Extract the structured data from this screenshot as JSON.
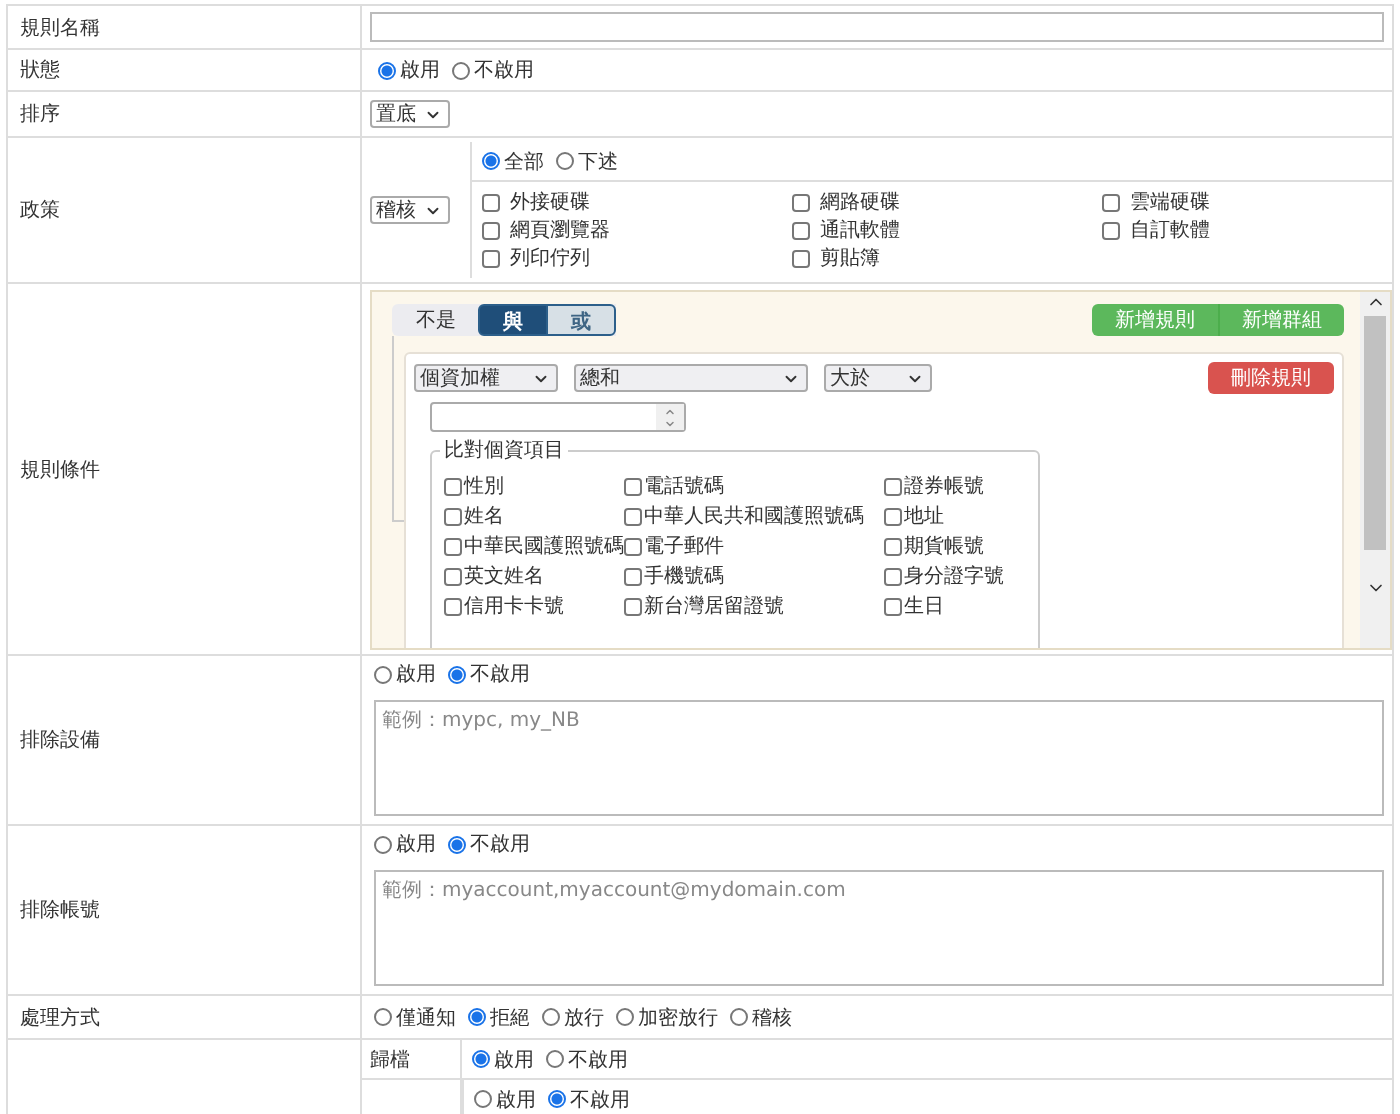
{
  "name_row": {
    "label": "規則名稱"
  },
  "status": {
    "label": "狀態",
    "options": [
      {
        "label": "啟用",
        "selected": true
      },
      {
        "label": "不啟用",
        "selected": false
      }
    ]
  },
  "order": {
    "label": "排序",
    "select": "置底"
  },
  "policy": {
    "label": "政策",
    "select": "稽核",
    "scope": [
      {
        "label": "全部",
        "selected": true
      },
      {
        "label": "下述",
        "selected": false
      }
    ],
    "items": [
      {
        "label": "外接硬碟",
        "checked": false
      },
      {
        "label": "網路硬碟",
        "checked": false
      },
      {
        "label": "雲端硬碟",
        "checked": false
      },
      {
        "label": "網頁瀏覽器",
        "checked": false
      },
      {
        "label": "通訊軟體",
        "checked": false
      },
      {
        "label": "自訂軟體",
        "checked": false
      },
      {
        "label": "列印佇列",
        "checked": false
      },
      {
        "label": "剪貼簿",
        "checked": false
      }
    ]
  },
  "conditions": {
    "label": "規則條件",
    "negate": {
      "label": "不是",
      "on": false
    },
    "logic": [
      {
        "label": "與",
        "selected": true
      },
      {
        "label": "或",
        "selected": false
      }
    ],
    "buttons": [
      "新增規則",
      "新增群組"
    ],
    "rule": {
      "field": "個資加權",
      "aggregate": "總和",
      "operator": "大於",
      "delete_button": "刪除規則",
      "group_title": "比對個資項目",
      "items": [
        {
          "label": "性別",
          "checked": false
        },
        {
          "label": "電話號碼",
          "checked": false
        },
        {
          "label": "證券帳號",
          "checked": false
        },
        {
          "label": "姓名",
          "checked": false
        },
        {
          "label": "中華人民共和國護照號碼",
          "checked": false
        },
        {
          "label": "地址",
          "checked": false
        },
        {
          "label": "中華民國護照號碼",
          "checked": false
        },
        {
          "label": "電子郵件",
          "checked": false
        },
        {
          "label": "期貨帳號",
          "checked": false
        },
        {
          "label": "英文姓名",
          "checked": false
        },
        {
          "label": "手機號碼",
          "checked": false
        },
        {
          "label": "身分證字號",
          "checked": false
        },
        {
          "label": "信用卡卡號",
          "checked": false
        },
        {
          "label": "新台灣居留證號",
          "checked": false
        },
        {
          "label": "生日",
          "checked": false
        }
      ]
    }
  },
  "exclude_devices": {
    "label": "排除設備",
    "options": [
      {
        "label": "啟用",
        "selected": false
      },
      {
        "label": "不啟用",
        "selected": true
      }
    ],
    "placeholder": "範例：mypc, my_NB"
  },
  "exclude_accounts": {
    "label": "排除帳號",
    "options": [
      {
        "label": "啟用",
        "selected": false
      },
      {
        "label": "不啟用",
        "selected": true
      }
    ],
    "placeholder": "範例：myaccount,myaccount@mydomain.com"
  },
  "action": {
    "label": "處理方式",
    "options": [
      {
        "label": "僅通知",
        "selected": false
      },
      {
        "label": "拒絕",
        "selected": true
      },
      {
        "label": "放行",
        "selected": false
      },
      {
        "label": "加密放行",
        "selected": false
      },
      {
        "label": "稽核",
        "selected": false
      }
    ]
  },
  "archive": {
    "label": "歸檔",
    "options": [
      {
        "label": "啟用",
        "selected": true
      },
      {
        "label": "不啟用",
        "selected": false
      }
    ]
  },
  "notify": {
    "options": [
      {
        "label": "啟用",
        "selected": false
      },
      {
        "label": "不啟用",
        "selected": true
      }
    ]
  }
}
